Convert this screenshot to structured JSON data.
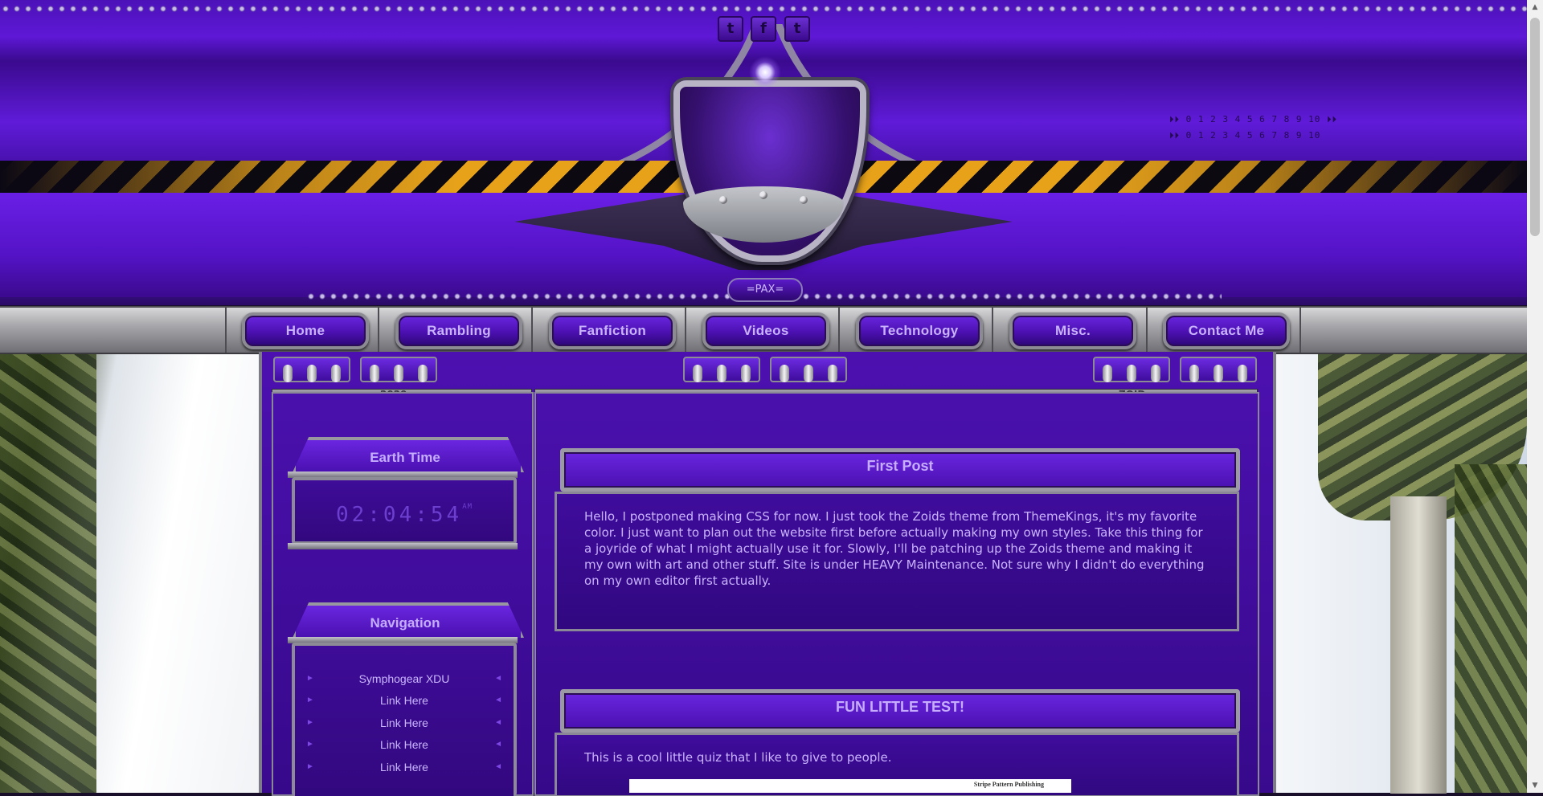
{
  "header": {
    "badge": "=PAX=",
    "social_icons": [
      "tumblr-icon",
      "facebook-icon",
      "twitter-icon"
    ],
    "social_glyphs": [
      "t",
      "f",
      "t"
    ],
    "counter_rows": [
      "⏵⏵ 0 1 2 3 4 5 6 7 8 9 10 ⏵⏵",
      "⏵⏵ 0 1 2 3 4 5 6 7 8 9 10"
    ]
  },
  "nav": {
    "items": [
      {
        "label": "Home"
      },
      {
        "label": "Rambling"
      },
      {
        "label": "Fanfiction"
      },
      {
        "label": "Videos"
      },
      {
        "label": "Technology"
      },
      {
        "label": "Misc."
      },
      {
        "label": "Contact Me"
      }
    ]
  },
  "rails": {
    "left_text": "2020",
    "right_text": "ZOID"
  },
  "sidebar": {
    "clock_widget": {
      "title": "Earth Time",
      "time": "02:04:54",
      "ampm": "AM"
    },
    "nav_widget": {
      "title": "Navigation",
      "links": [
        {
          "label": "Symphogear XDU"
        },
        {
          "label": "Link Here"
        },
        {
          "label": "Link Here"
        },
        {
          "label": "Link Here"
        },
        {
          "label": "Link Here"
        }
      ]
    }
  },
  "posts": [
    {
      "title": "First Post",
      "body": "Hello, I postponed making CSS for now. I just took the Zoids theme from ThemeKings, it's my favorite color. I just want to plan out the website first before actually making my own styles. Take this thing for a joyride of what I might actually use it for. Slowly, I'll be patching up the Zoids theme and making it my own with art and other stuff. Site is under HEAVY Maintenance. Not sure why I didn't do everything on my own editor first actually."
    },
    {
      "title": "FUN LITTLE TEST!",
      "body": "This is a cool little quiz that I like to give to people.",
      "embed_caption": "Stripe Pattern Publishing"
    }
  ],
  "colors": {
    "accent_purple": "#5e18d6",
    "hazard_yellow": "#e7a21a",
    "text_lavender": "#c9b3ff",
    "metal_gray": "#8c8a93"
  }
}
